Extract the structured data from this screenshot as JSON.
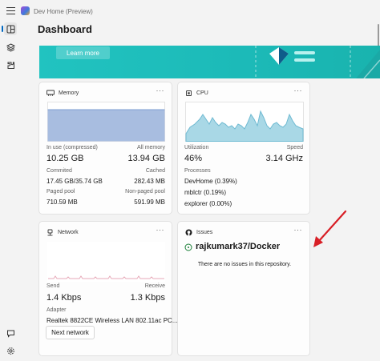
{
  "app": {
    "title": "Dev Home (Preview)",
    "page_title": "Dashboard"
  },
  "nav": {
    "items": [
      {
        "icon": "dashboard-icon"
      },
      {
        "icon": "package-icon"
      },
      {
        "icon": "extensions-icon"
      }
    ],
    "bottom": [
      {
        "icon": "feedback-icon"
      },
      {
        "icon": "settings-icon"
      }
    ]
  },
  "banner": {
    "button_label": "Learn more"
  },
  "memory": {
    "title": "Memory",
    "more": "···",
    "in_use_label": "In use (compressed)",
    "all_memory_label": "All memory",
    "in_use_value": "10.25 GB",
    "all_memory_value": "13.94 GB",
    "committed_label": "Commited",
    "cached_label": "Cached",
    "committed_value": "17.45 GB/35.74 GB",
    "cached_value": "282.43 MB",
    "paged_label": "Paged pool",
    "nonpaged_label": "Non-paged pool",
    "paged_value": "710.59 MB",
    "nonpaged_value": "591.99 MB"
  },
  "cpu": {
    "title": "CPU",
    "more": "···",
    "utilization_label": "Utilization",
    "speed_label": "Speed",
    "utilization_value": "46%",
    "speed_value": "3.14 GHz",
    "processes_label": "Processes",
    "processes": [
      "DevHome (0.39%)",
      "mblctr (0.19%)",
      "explorer (0.00%)"
    ]
  },
  "network": {
    "title": "Network",
    "more": "···",
    "send_label": "Send",
    "receive_label": "Receive",
    "send_value": "1.4 Kbps",
    "receive_value": "1.3 Kbps",
    "adapter_label": "Adapter",
    "adapter_value": "Realtek 8822CE Wireless LAN 802.11ac PC...",
    "next_button": "Next network"
  },
  "issues": {
    "title": "Issues",
    "more": "···",
    "repo": "rajkumark37/Docker",
    "empty_message": "There are no issues in this repository."
  },
  "colors": {
    "accent": "#0067c0",
    "banner": "#1cbab8",
    "memory_fill": "#a8bde0",
    "cpu_fill": "#a9d8e6",
    "network_line": "#e7a9b8",
    "issue_green": "#1a7f37",
    "annotation_red": "#d81f26"
  }
}
